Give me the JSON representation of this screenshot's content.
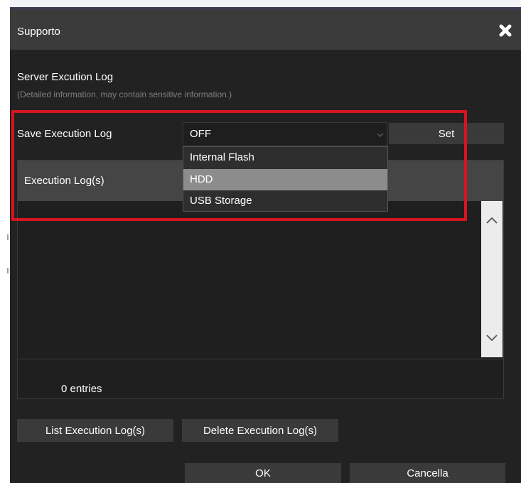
{
  "dialog": {
    "title": "Supporto"
  },
  "section": {
    "title": "Server Excution Log",
    "note": "(Detailed information, may contain sensitive information.)"
  },
  "save_log": {
    "label": "Save Execution Log",
    "selected_value": "OFF",
    "set_label": "Set",
    "options": [
      "Internal Flash",
      "HDD",
      "USB Storage"
    ],
    "hovered_option": "HDD"
  },
  "log_list": {
    "header": "Execution Log(s)",
    "entries_text": "0 entries"
  },
  "actions": {
    "list_label": "List Execution Log(s)",
    "delete_label": "Delete Execution Log(s)",
    "ok_label": "OK",
    "cancel_label": "Cancella"
  },
  "colors": {
    "dialog_bg": "#222222",
    "titlebar_bg": "#3b3b3b",
    "highlight": "#d8141e",
    "option_hover": "#8c8c8c"
  },
  "icons": {
    "close": "close-x-icon",
    "dropdown": "chevron-down-icon",
    "scroll_up": "chevron-up-icon",
    "scroll_down": "chevron-down-icon"
  }
}
